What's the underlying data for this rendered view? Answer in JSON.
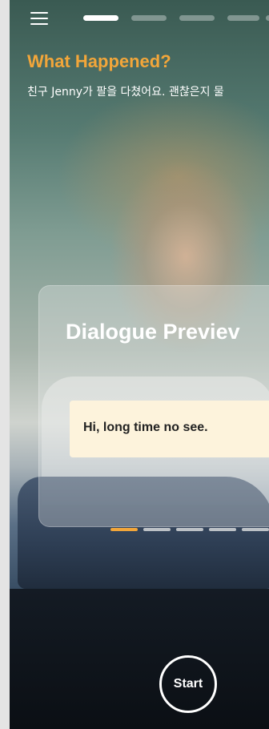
{
  "header": {
    "menu_icon": "hamburger-menu-icon",
    "progress": {
      "total": 5,
      "current": 1
    }
  },
  "intro": {
    "title": "What Happened?",
    "description": "친구 Jenny가 팔을 다쳤어요. 괜찮은지 물"
  },
  "card": {
    "title": "Dialogue Previev",
    "dialogue_line": "Hi, long time no see."
  },
  "carousel": {
    "total": 5,
    "current": 1
  },
  "footer": {
    "start_label": "Start"
  },
  "colors": {
    "accent": "#f2a63a",
    "bubble_background": "#fdf3dc",
    "text_light": "#ffffff"
  }
}
